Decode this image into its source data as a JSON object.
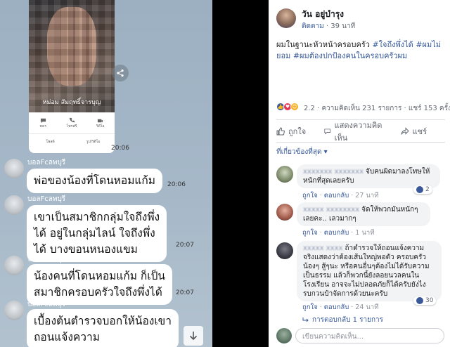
{
  "chat": {
    "photo_caption": "หม่อม สัมฤทธิ์จารบุญ",
    "photo_buttons": [
      "ทคร",
      "โทรฟรี",
      "วิดีโอ"
    ],
    "photo_buttons2": [
      "โพสต์",
      "รูป/วิดีโอ"
    ],
    "photo_time": "20:06",
    "messages": [
      {
        "sender": "บอลFcลพบุรี",
        "lines": [
          "พ่อของน้องที่โดนหอมแก้ม"
        ],
        "time": "20:06"
      },
      {
        "sender": "บอลFcลพบุรี",
        "lines": [
          "เขาเป็นสมาชิกกลุ่มใจถึงพึ่ง",
          "ได้ อยู่ในกลุ่มไลน์ ใจถึงพึ่ง",
          "ได้ บางขอนหนองแขม"
        ],
        "time": "20:07"
      },
      {
        "sender": "บอลFcลพบุรี",
        "lines": [
          "น้องคนที่โดนหอมแก้ม ก็เป็น",
          "สมาชิกครอบครัวใจถึงพึ่งได้"
        ],
        "time": "20:07"
      },
      {
        "sender": "บอลFcลพบุรี",
        "lines": [
          "เบื้องต้นตำรวจบอกให้น้องเขา",
          "ถอนแจ้งความ"
        ],
        "time": ""
      }
    ]
  },
  "fb": {
    "author": "วัน อยู่บำรุง",
    "follow": "ติดตาม",
    "posted_ago": "39 นาที",
    "body_plain": "ผมในฐานะหัวหน้าครอบครัว ",
    "hashtags": [
      "#ใจถึงพึ่งได้",
      "#ผมไม่ยอม",
      "#ผมต้องปกป้องคนในครอบครัวผม"
    ],
    "reaction_count": "2.2",
    "comments_count": "ความคิดเห็น 231 รายการ",
    "shares_count": "แชร์ 153 ครั้ง",
    "actions": [
      "ถูกใจ",
      "แสดงความคิดเห็น",
      "แชร์"
    ],
    "sort_label": "ที่เกี่ยวข้องที่สุด ▾",
    "comments": [
      {
        "name": "xxxxxxx xxxxxxx",
        "text": "จับคนผิดมาลงโทษให้หนักที่สุดเลยครับ",
        "like": "ถูกใจ",
        "reply": "ตอบกลับ",
        "ago": "27 นาที",
        "likes": "2"
      },
      {
        "name": "xxxxx xxxxxxxx",
        "text": "จัดให้พวกมันหนักๆเลยคะ.. เลวมากๆ",
        "like": "ถูกใจ",
        "reply": "ตอบกลับ",
        "ago": "1 นาที",
        "likes": ""
      },
      {
        "name": "xxxxx xxxx",
        "text": "ถ้าตำรวจให้ถอนแจ้งความจริงแสดงว่าต้องเส้นใหญ่พอตัว ครอบครัวน้องๆ สู้ๆนะ หรือคนอื่นๆต้องไม่ได้รับความเป็นธรรม แล้วก็พวกนี้ยังลอยนวลคนในโรงเรียน อาจจะไม่ปลอดภัยก็ได้ครับยังไงรบกวนป๋าจัดการด้วยนะครับ",
        "like": "ถูกใจ",
        "reply": "ตอบกลับ",
        "ago": "24 นาที",
        "likes": "30"
      }
    ],
    "replies_link": "การตอบกลับ 1 รายการ",
    "compose_placeholder": "เขียนความคิดเห็น..."
  },
  "colors": {
    "fb_link": "#365899",
    "chat_bg": "#a6b8c8",
    "like_blue": "#3b5998",
    "love_red": "#e8344e"
  }
}
